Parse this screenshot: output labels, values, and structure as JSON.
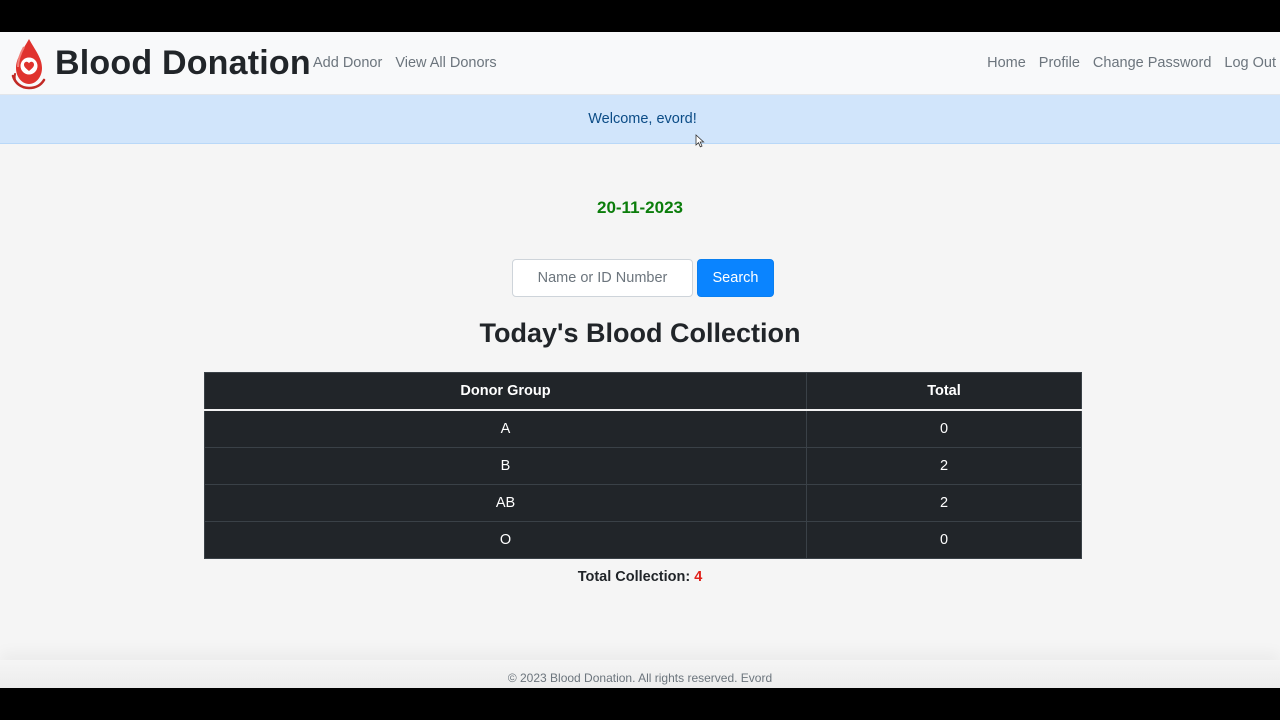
{
  "brand": {
    "name": "Blood Donation",
    "logo_icon": "blood-drop-heart-icon",
    "accent": "#e0332e"
  },
  "nav": {
    "left": [
      {
        "label": "Add Donor"
      },
      {
        "label": "View All Donors"
      }
    ],
    "right": [
      {
        "label": "Home"
      },
      {
        "label": "Profile"
      },
      {
        "label": "Change Password"
      },
      {
        "label": "Log Out"
      }
    ]
  },
  "alert": {
    "text": "Welcome, evord!"
  },
  "date": "20-11-2023",
  "search": {
    "placeholder": "Name or ID Number",
    "value": "",
    "button_label": "Search"
  },
  "collection": {
    "title": "Today's Blood Collection",
    "headers": [
      "Donor Group",
      "Total"
    ],
    "rows": [
      {
        "group": "A",
        "total": "0"
      },
      {
        "group": "B",
        "total": "2"
      },
      {
        "group": "AB",
        "total": "2"
      },
      {
        "group": "O",
        "total": "0"
      }
    ],
    "total_label": "Total Collection:",
    "total_value": "4"
  },
  "footer": {
    "text": "© 2023 Blood Donation. All rights reserved. Evord"
  },
  "colors": {
    "date": "#0b7d0b",
    "search_button": "#0a84ff",
    "table_bg": "#212529",
    "total_value": "#e0211b"
  }
}
